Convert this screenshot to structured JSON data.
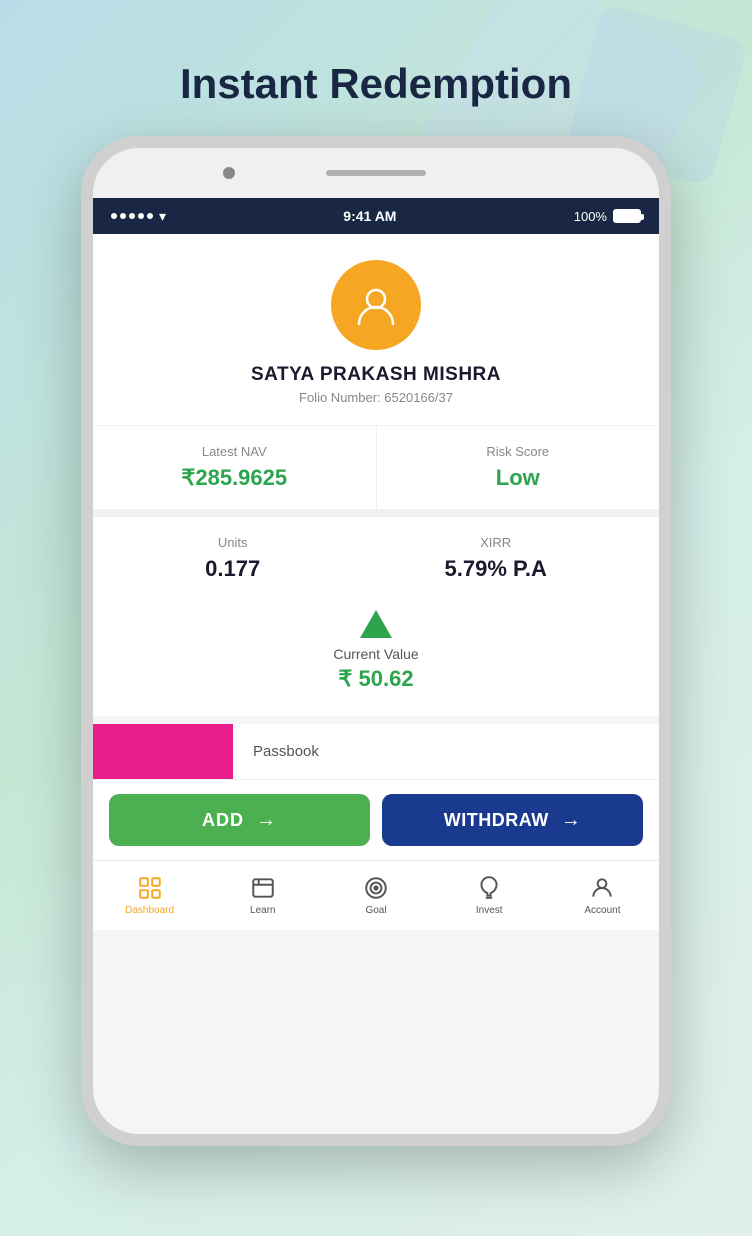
{
  "page": {
    "title": "Instant Redemption"
  },
  "status_bar": {
    "time": "9:41 AM",
    "battery": "100%"
  },
  "profile": {
    "name": "SATYA PRAKASH MISHRA",
    "folio_label": "Folio Number:",
    "folio_number": "6520166/37"
  },
  "stats": {
    "latest_nav_label": "Latest NAV",
    "latest_nav_value": "₹285.9625",
    "risk_score_label": "Risk Score",
    "risk_score_value": "Low"
  },
  "units": {
    "units_label": "Units",
    "units_value": "0.177",
    "xirr_label": "XIRR",
    "xirr_value": "5.79% P.A"
  },
  "current_value": {
    "label": "Current Value",
    "value": "₹ 50.62"
  },
  "passbook": {
    "label": "Passbook"
  },
  "buttons": {
    "add_label": "ADD",
    "withdraw_label": "WITHDRAW"
  },
  "nav": {
    "items": [
      {
        "label": "Dashboard",
        "id": "dashboard",
        "active": true
      },
      {
        "label": "Learn",
        "id": "learn",
        "active": false
      },
      {
        "label": "Goal",
        "id": "goal",
        "active": false
      },
      {
        "label": "Invest",
        "id": "invest",
        "active": false
      },
      {
        "label": "Account",
        "id": "account",
        "active": false
      }
    ]
  }
}
